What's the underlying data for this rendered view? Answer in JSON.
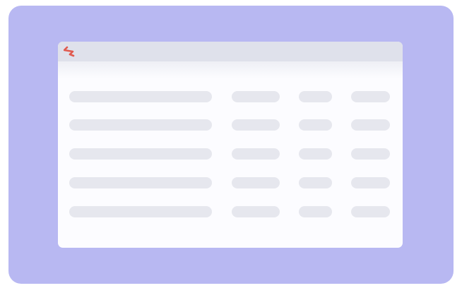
{
  "app": {
    "logo_icon": "app-logo-icon",
    "accent_color": "#e05a4f",
    "background_color": "#b8b8f2"
  },
  "table": {
    "row_count": 5,
    "column_count": 4,
    "placeholder_color": "#e6e7ee"
  }
}
